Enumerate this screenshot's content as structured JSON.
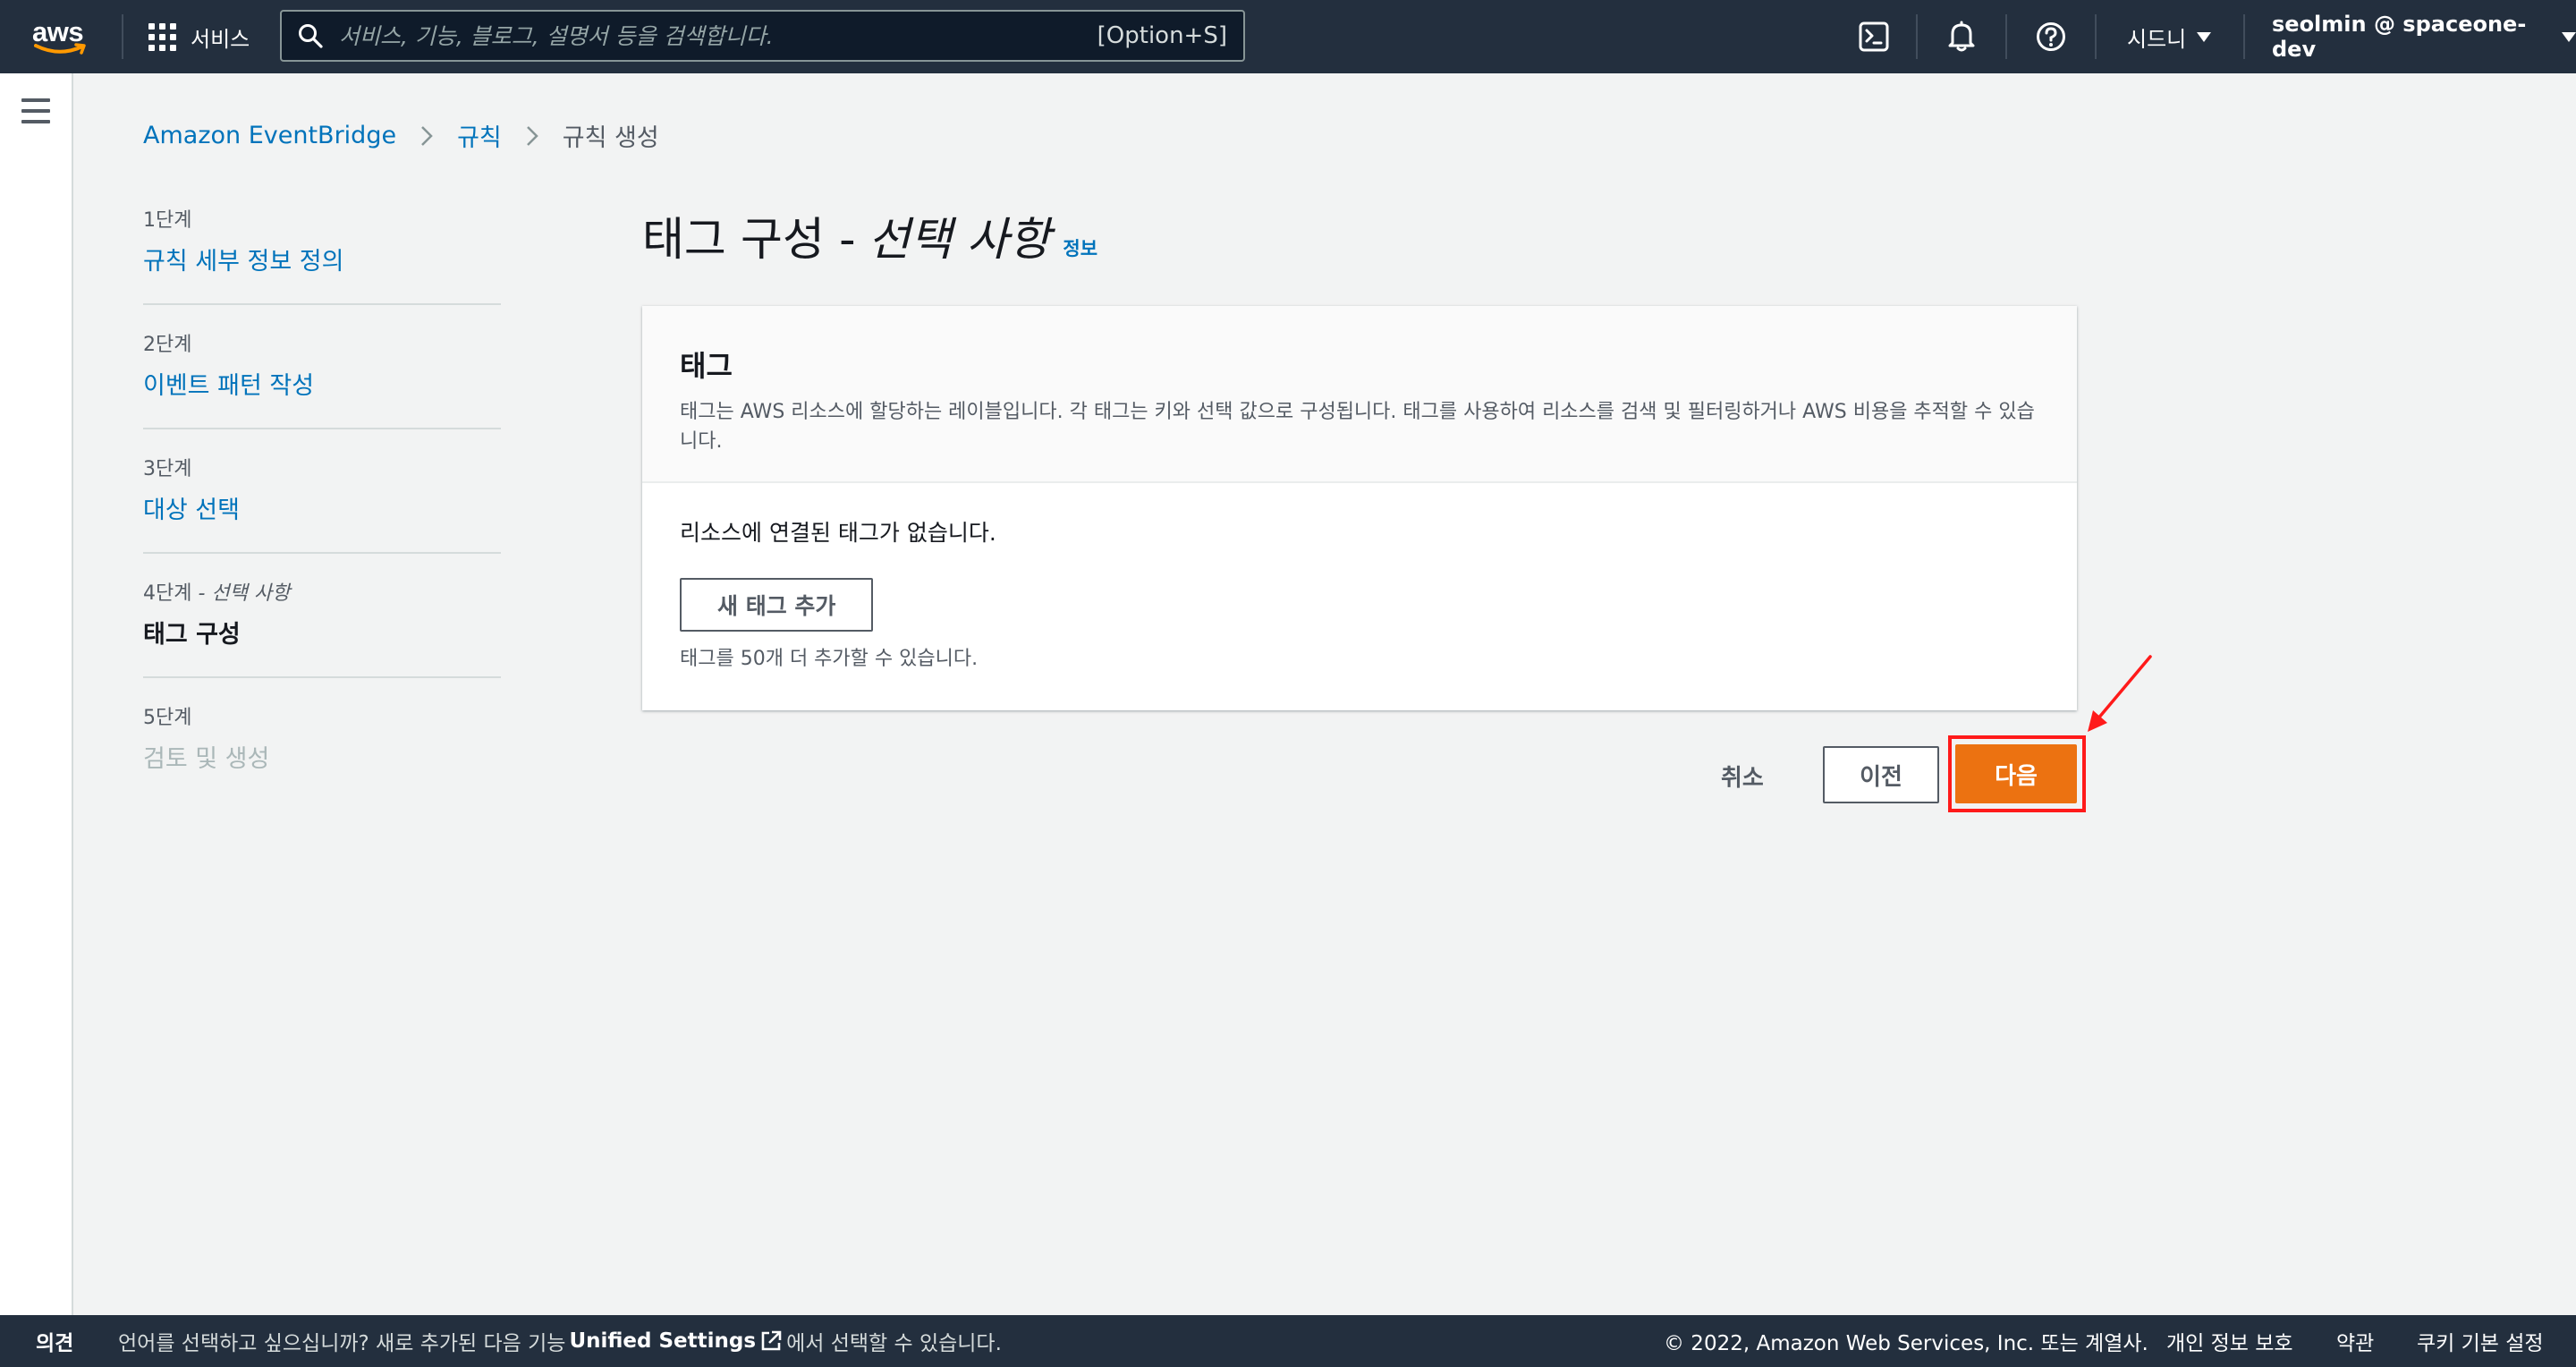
{
  "topnav": {
    "logo_text": "aws",
    "services_label": "서비스",
    "search_placeholder": "서비스, 기능, 블로그, 설명서 등을 검색합니다.",
    "search_shortcut": "[Option+S]",
    "region": "시드니",
    "account": "seolmin @ spaceone-dev"
  },
  "breadcrumb": {
    "items": [
      "Amazon EventBridge",
      "규칙"
    ],
    "current": "규칙 생성"
  },
  "steps": [
    {
      "num": "1단계",
      "label": "규칙 세부 정보 정의"
    },
    {
      "num": "2단계",
      "label": "이벤트 패턴 작성"
    },
    {
      "num": "3단계",
      "label": "대상 선택"
    },
    {
      "num": "4단계",
      "num_suffix": " - 선택 사항",
      "label": "태그 구성"
    },
    {
      "num": "5단계",
      "label": "검토 및 생성"
    }
  ],
  "page": {
    "title": "태그 구성 -",
    "title_optional": "선택 사항",
    "info_link": "정보"
  },
  "panel": {
    "title": "태그",
    "description": "태그는 AWS 리소스에 할당하는 레이블입니다. 각 태그는 키와 선택 값으로 구성됩니다. 태그를 사용하여 리소스를 검색 및 필터링하거나 AWS 비용을 추적할 수 있습니다.",
    "empty_text": "리소스에 연결된 태그가 없습니다.",
    "add_button": "새 태그 추가",
    "hint": "태그를 50개 더 추가할 수 있습니다."
  },
  "actions": {
    "cancel": "취소",
    "previous": "이전",
    "next": "다음"
  },
  "footer": {
    "feedback": "의견",
    "lang_prefix": "언어를 선택하고 싶으십니까? 새로 추가된 다음 기능",
    "lang_link": "Unified Settings",
    "lang_suffix": "에서 선택할 수 있습니다.",
    "copyright": "© 2022, Amazon Web Services, Inc. 또는 계열사.",
    "privacy": "개인 정보 보호",
    "terms": "약관",
    "cookies": "쿠키 기본 설정"
  },
  "colors": {
    "nav_bg": "#232f3e",
    "link": "#0073bb",
    "primary": "#ec7211",
    "annotation": "#ff1a1a"
  }
}
